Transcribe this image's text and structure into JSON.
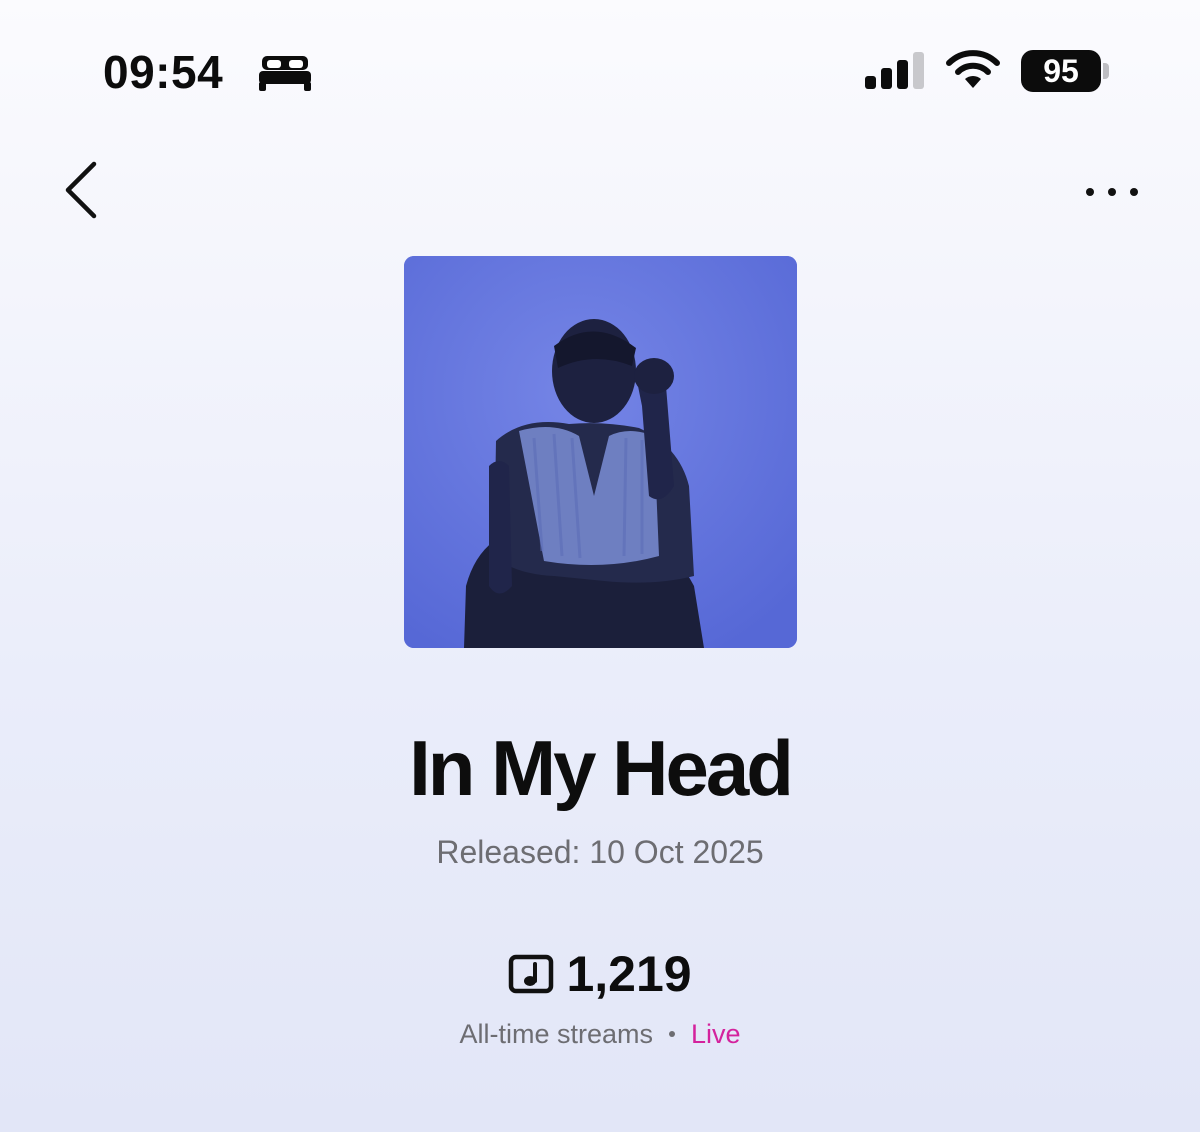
{
  "status_bar": {
    "time": "09:54",
    "focus_icon": "bed-icon",
    "signal_icon": "cellular-signal-icon",
    "wifi_icon": "wifi-icon",
    "battery_level": "95"
  },
  "nav": {
    "back_icon": "chevron-left-icon",
    "more_icon": "more-dots-icon"
  },
  "track": {
    "artwork": "album-artwork",
    "title": "In My Head",
    "released": "Released: 10 Oct 2025",
    "streams_icon": "music-note-icon",
    "streams_count": "1,219",
    "streams_label": "All-time streams",
    "live_label": "Live"
  },
  "colors": {
    "live": "#d4229d",
    "artwork_bg": "#6277de",
    "muted_text": "#6d6d72"
  }
}
